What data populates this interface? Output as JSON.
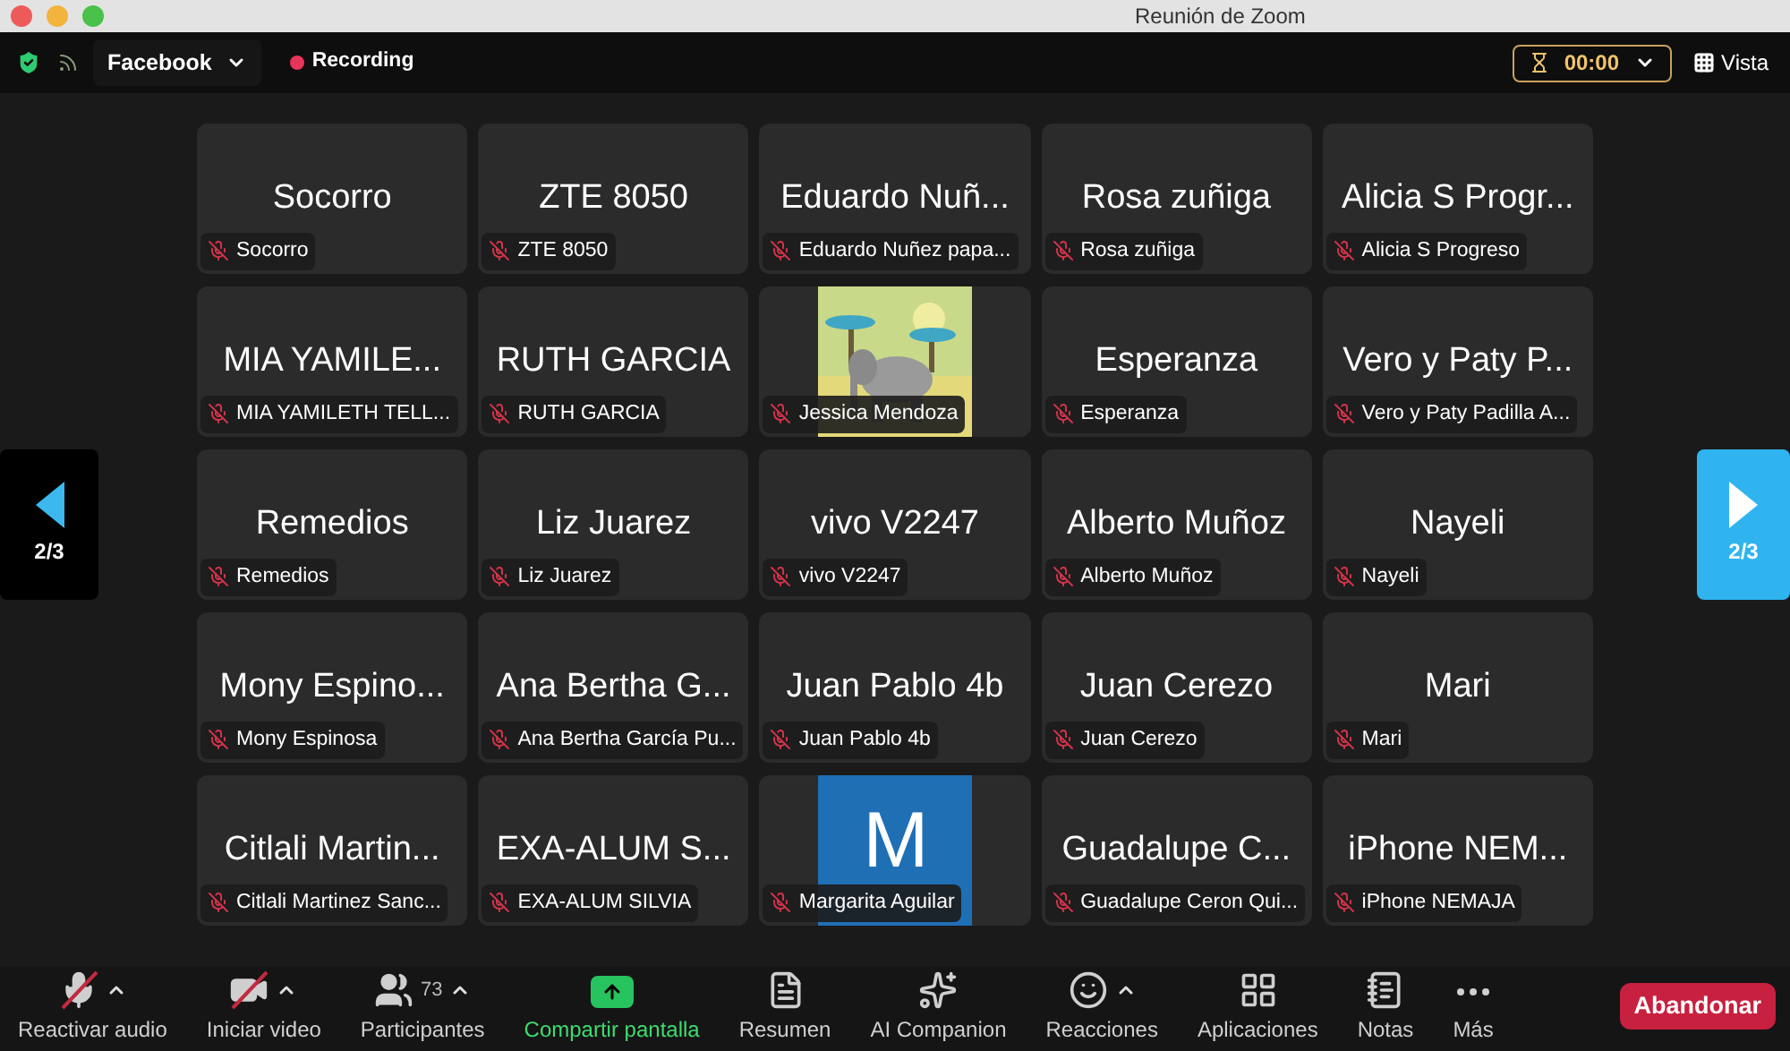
{
  "window": {
    "title": "Reunión de Zoom"
  },
  "top_bar": {
    "stream": "Facebook",
    "recording": "Recording",
    "timer": "00:00",
    "view": "Vista"
  },
  "pager": [
    {
      "kind": "previous",
      "label": "2/3",
      "highlighted": false
    },
    {
      "kind": "next",
      "label": "2/3",
      "highlighted": true
    }
  ],
  "tiles": [
    {
      "kind": "name",
      "title": "Socorro",
      "label": "Socorro"
    },
    {
      "kind": "name",
      "title": "ZTE 8050",
      "label": "ZTE 8050"
    },
    {
      "kind": "name",
      "title": "Eduardo Nuñ...",
      "label": "Eduardo Nuñez papa..."
    },
    {
      "kind": "name",
      "title": "Rosa zuñiga",
      "label": "Rosa zuñiga"
    },
    {
      "kind": "name",
      "title": "Alicia S Progr...",
      "label": "Alicia S Progreso"
    },
    {
      "kind": "name",
      "title": "MIA YAMILE...",
      "label": "MIA YAMILETH TELL..."
    },
    {
      "kind": "name",
      "title": "RUTH GARCIA",
      "label": "RUTH GARCIA"
    },
    {
      "kind": "picture",
      "label": "Jessica Mendoza"
    },
    {
      "kind": "name",
      "title": "Esperanza",
      "label": "Esperanza"
    },
    {
      "kind": "name",
      "title": "Vero y Paty P...",
      "label": "Vero y Paty Padilla A..."
    },
    {
      "kind": "name",
      "title": "Remedios",
      "label": "Remedios"
    },
    {
      "kind": "name",
      "title": "Liz Juarez",
      "label": "Liz Juarez"
    },
    {
      "kind": "name",
      "title": "vivo V2247",
      "label": "vivo V2247"
    },
    {
      "kind": "name",
      "title": "Alberto Muñoz",
      "label": "Alberto Muñoz"
    },
    {
      "kind": "name",
      "title": "Nayeli",
      "label": "Nayeli"
    },
    {
      "kind": "name",
      "title": "Mony Espino...",
      "label": "Mony Espinosa"
    },
    {
      "kind": "name",
      "title": "Ana Bertha G...",
      "label": "Ana Bertha García Pu..."
    },
    {
      "kind": "name",
      "title": "Juan Pablo 4b",
      "label": "Juan Pablo 4b"
    },
    {
      "kind": "name",
      "title": "Juan Cerezo",
      "label": "Juan Cerezo"
    },
    {
      "kind": "name",
      "title": "Mari",
      "label": "Mari"
    },
    {
      "kind": "name",
      "title": "Citlali Martin...",
      "label": "Citlali Martinez Sanc..."
    },
    {
      "kind": "name",
      "title": "EXA-ALUM S...",
      "label": "EXA-ALUM SILVIA"
    },
    {
      "kind": "letter",
      "title": "M",
      "label": "Margarita Aguilar"
    },
    {
      "kind": "name",
      "title": "Guadalupe C...",
      "label": "Guadalupe Ceron Qui..."
    },
    {
      "kind": "name",
      "title": "iPhone NEM...",
      "label": "iPhone NEMAJA"
    }
  ],
  "toolbar": [
    {
      "kind": "mic",
      "label": "Reactivar audio",
      "off": true,
      "menu": true
    },
    {
      "kind": "video",
      "label": "Iniciar video",
      "off": true,
      "menu": true
    },
    {
      "kind": "participants",
      "label": "Participantes",
      "count": "73",
      "menu": true
    },
    {
      "kind": "share",
      "label": "Compartir pantalla"
    },
    {
      "kind": "summary",
      "label": "Resumen"
    },
    {
      "kind": "ai",
      "label": "AI Companion"
    },
    {
      "kind": "reactions",
      "label": "Reacciones",
      "menu": true
    },
    {
      "kind": "apps",
      "label": "Aplicaciones"
    },
    {
      "kind": "notes",
      "label": "Notas"
    },
    {
      "kind": "more",
      "label": "Más"
    }
  ],
  "leave_button": "Abandonar"
}
